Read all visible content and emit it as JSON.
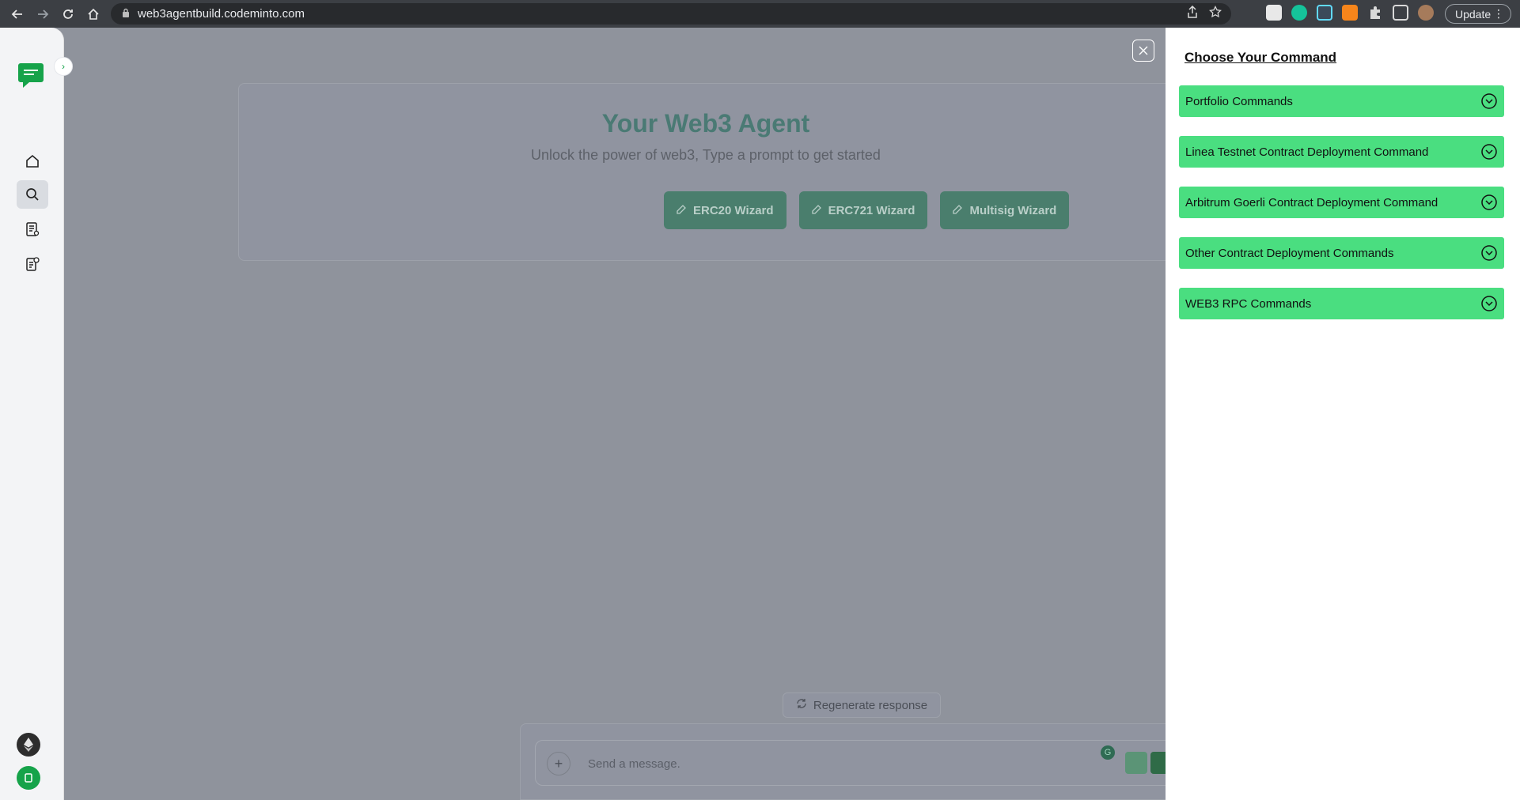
{
  "browser": {
    "url": "web3agentbuild.codeminto.com",
    "update_label": "Update"
  },
  "main": {
    "title": "Your Web3 Agent",
    "subtitle": "Unlock the power of web3, Type a prompt to get started",
    "wizards": [
      "ERC20 Wizard",
      "ERC721 Wizard",
      "Multisig Wizard"
    ],
    "regenerate_label": "Regenerate response",
    "message_placeholder": "Send a message."
  },
  "drawer": {
    "title": "Choose Your Command",
    "commands": [
      "Portfolio Commands",
      "Linea Testnet Contract Deployment Command",
      "Arbitrum Goerli Contract Deployment Command",
      "Other Contract Deployment Commands",
      "WEB3 RPC Commands"
    ]
  },
  "colors": {
    "accent_green": "#4ade80",
    "brand_green": "#16a34a",
    "overlay": "#8f939c"
  }
}
